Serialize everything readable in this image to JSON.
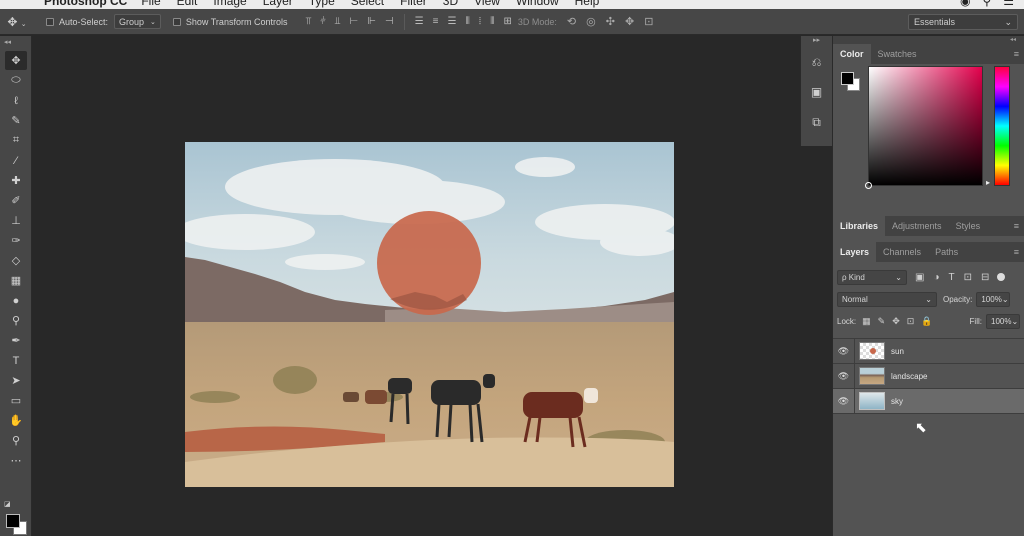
{
  "app": {
    "menu": {
      "app_name": "Photoshop CC",
      "items": [
        "File",
        "Edit",
        "Image",
        "Layer",
        "Type",
        "Select",
        "Filter",
        "3D",
        "View",
        "Window",
        "Help"
      ]
    }
  },
  "options_bar": {
    "tool_icon": "move-icon",
    "auto_select_label": "Auto-Select:",
    "auto_select_value": "Group",
    "show_transform_label": "Show Transform Controls",
    "mode_3d_label": "3D Mode:",
    "workspace_value": "Essentials"
  },
  "tools": [
    "move",
    "marquee",
    "lasso",
    "quick-select",
    "crop",
    "eyedropper",
    "healing-brush",
    "brush",
    "clone-stamp",
    "history-brush",
    "eraser",
    "gradient",
    "blur",
    "dodge",
    "pen",
    "type",
    "path-select",
    "shape",
    "hand",
    "zoom",
    "more"
  ],
  "dock": [
    "history-icon",
    "layer-comps-icon",
    "properties-icon"
  ],
  "color_panel": {
    "tabs": [
      "Color",
      "Swatches"
    ],
    "active_tab": "Color",
    "foreground_color": "#000000",
    "background_color": "#ffffff",
    "picker_hue": "#e3004c"
  },
  "libraries_panel": {
    "tabs": [
      "Libraries",
      "Adjustments",
      "Styles"
    ],
    "active_tab": "Libraries"
  },
  "layers_panel": {
    "tabs": [
      "Layers",
      "Channels",
      "Paths"
    ],
    "active_tab": "Layers",
    "filter_label": "ρ Kind",
    "blend_mode": "Normal",
    "opacity_label": "Opacity:",
    "opacity_value": "100%",
    "lock_label": "Lock:",
    "fill_label": "Fill:",
    "fill_value": "100%",
    "layers": [
      {
        "name": "sun",
        "visible": true,
        "selected": false
      },
      {
        "name": "landscape",
        "visible": true,
        "selected": false
      },
      {
        "name": "sky",
        "visible": true,
        "selected": true
      }
    ]
  },
  "document": {
    "sun_color": "#c8684c"
  }
}
